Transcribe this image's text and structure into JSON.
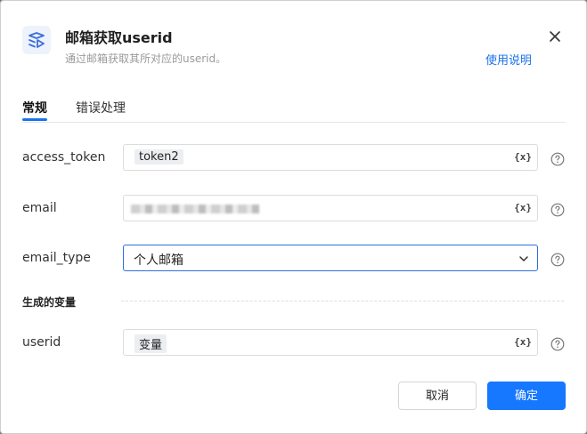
{
  "dialog": {
    "title": "邮箱获取userid",
    "subtitle": "通过邮箱获取其所对应的userid。",
    "help_link": "使用说明",
    "icon": "app-icon",
    "close_icon": "close-icon"
  },
  "tabs": [
    {
      "label": "常规",
      "active": true
    },
    {
      "label": "错误处理",
      "active": false
    }
  ],
  "fields": {
    "access_token": {
      "label": "access_token",
      "value": "token2",
      "var_button": "{x}"
    },
    "email": {
      "label": "email",
      "value": "",
      "var_button": "{x}"
    },
    "email_type": {
      "label": "email_type",
      "value": "个人邮箱"
    }
  },
  "output_section": {
    "title": "生成的变量",
    "userid": {
      "label": "userid",
      "value": "变量",
      "var_button": "{x}"
    }
  },
  "buttons": {
    "cancel": "取消",
    "ok": "确定"
  },
  "colors": {
    "accent": "#1677ff",
    "link": "#1a73e8"
  }
}
